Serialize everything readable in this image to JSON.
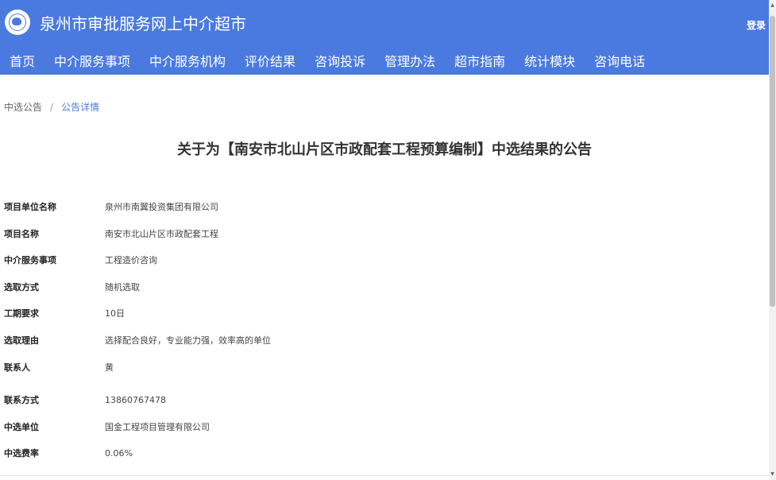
{
  "header": {
    "title": "泉州市审批服务网上中介超市",
    "login_label": "登录"
  },
  "nav": {
    "items": [
      {
        "label": "首页"
      },
      {
        "label": "中介服务事项"
      },
      {
        "label": "中介服务机构"
      },
      {
        "label": "评价结果"
      },
      {
        "label": "咨询投诉"
      },
      {
        "label": "管理办法"
      },
      {
        "label": "超市指南"
      },
      {
        "label": "统计模块"
      },
      {
        "label": "咨询电话"
      }
    ]
  },
  "breadcrumb": {
    "parent": "中选公告",
    "separator": "/",
    "current": "公告详情"
  },
  "notice": {
    "title": "关于为【南安市北山片区市政配套工程预算编制】中选结果的公告",
    "fields": [
      {
        "label": "项目单位名称",
        "value": "泉州市南翼投资集团有限公司"
      },
      {
        "label": "项目名称",
        "value": "南安市北山片区市政配套工程"
      },
      {
        "label": "中介服务事项",
        "value": "工程造价咨询"
      },
      {
        "label": "选取方式",
        "value": "随机选取"
      },
      {
        "label": "工期要求",
        "value": "10日"
      },
      {
        "label": "选取理由",
        "value": "选择配合良好，专业能力强，效率高的单位"
      },
      {
        "label": "联系人",
        "value": "黄"
      },
      {
        "label": "联系方式",
        "value": "13860767478"
      },
      {
        "label": "中选单位",
        "value": "国金工程项目管理有限公司"
      },
      {
        "label": "中选费率",
        "value": "0.06%"
      }
    ]
  },
  "colors": {
    "header_bg": "#4a7ae0",
    "link": "#4a7ae0"
  }
}
